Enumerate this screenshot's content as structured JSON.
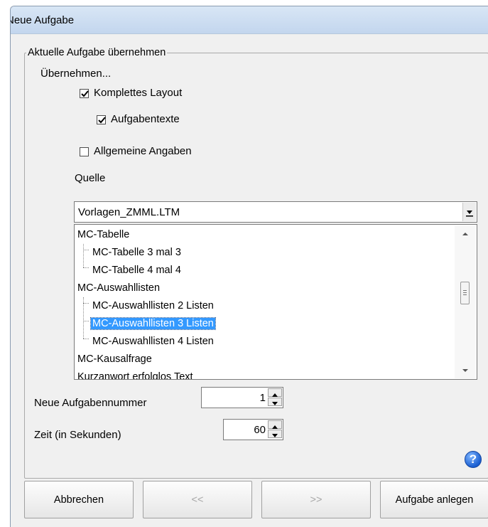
{
  "window": {
    "title": "Neue Aufgabe"
  },
  "group": {
    "legend": "Aktuelle Aufgabe übernehmen"
  },
  "take_over_label": "Übernehmen...",
  "checkboxes": {
    "komplettes_layout": {
      "label": "Komplettes Layout",
      "checked": true
    },
    "aufgabentexte": {
      "label": "Aufgabentexte",
      "checked": true
    },
    "allgemeine_angaben": {
      "label": "Allgemeine Angaben",
      "checked": false
    }
  },
  "source": {
    "label": "Quelle",
    "selected": "Vorlagen_ZMML.LTM"
  },
  "tree": {
    "items": [
      {
        "label": "MC-Tabelle",
        "level": 0
      },
      {
        "label": "MC-Tabelle 3 mal 3",
        "level": 1
      },
      {
        "label": "MC-Tabelle 4 mal 4",
        "level": 1
      },
      {
        "label": "MC-Auswahllisten",
        "level": 0
      },
      {
        "label": "MC-Auswahllisten 2 Listen",
        "level": 1
      },
      {
        "label": "MC-Auswahllisten 3 Listen",
        "level": 1,
        "selected": true
      },
      {
        "label": "MC-Auswahllisten 4 Listen",
        "level": 1
      },
      {
        "label": "MC-Kausalfrage",
        "level": 0
      },
      {
        "label": "Kurzanwort erfolglos Text",
        "level": 0
      }
    ]
  },
  "fields": {
    "task_number": {
      "label": "Neue Aufgabennummer",
      "value": "1"
    },
    "time": {
      "label": "Zeit (in Sekunden)",
      "value": "60"
    }
  },
  "buttons": {
    "cancel": "Abbrechen",
    "prev": "<<",
    "next": ">>",
    "create": "Aufgabe anlegen"
  },
  "icons": {
    "help": "help-icon",
    "dropdown": "chevron-down-icon"
  },
  "colors": {
    "selection": "#3399ff",
    "titlebar": "#c3d6ee"
  }
}
